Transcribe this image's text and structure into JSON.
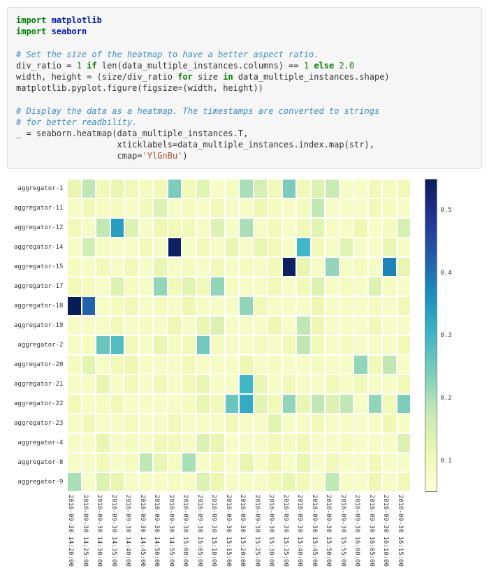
{
  "code": {
    "l1a": "import",
    "l1b": "matplotlib",
    "l2a": "import",
    "l2b": "seaborn",
    "c1": "# Set the size of the heatmap to have a better aspect ratio.",
    "l3": "div_ratio = 1 if len(data_multiple_instances.columns) == 1 else 2.0",
    "l4": "width, height = (size/div_ratio for size in data_multiple_instances.shape)",
    "l5": "matplotlib.pyplot.figure(figsize=(width, height))",
    "c2": "# Display the data as a heatmap. The timestamps are converted to strings",
    "c3": "# for better readbility.",
    "l6": "_ = seaborn.heatmap(data_multiple_instances.T,",
    "l7": "                    xticklabels=data_multiple_instances.index.map(str),",
    "l8": "                    cmap='YlGnBu')"
  },
  "chart_data": {
    "type": "heatmap",
    "cmap": "YlGnBu",
    "vmin": 0.05,
    "vmax": 0.55,
    "colorbar_ticks": [
      "0.1",
      "0.2",
      "0.3",
      "0.4",
      "0.5"
    ],
    "y_labels": [
      "aggregator-1",
      "aggregator-11",
      "aggregator-12",
      "aggregator-14",
      "aggregator-15",
      "aggregator-17",
      "aggregator-18",
      "aggregator-19",
      "aggregator-2",
      "aggregator-20",
      "aggregator-21",
      "aggregator-22",
      "aggregator-23",
      "aggregator-4",
      "aggregator-8",
      "aggregator-9"
    ],
    "x_labels": [
      "2016-09-30 14:20:00",
      "2016-09-30 14:25:00",
      "2016-09-30 14:30:00",
      "2016-09-30 14:35:00",
      "2016-09-30 14:40:00",
      "2016-09-30 14:45:00",
      "2016-09-30 14:50:00",
      "2016-09-30 14:55:00",
      "2016-09-30 15:00:00",
      "2016-09-30 15:05:00",
      "2016-09-30 15:10:00",
      "2016-09-30 15:15:00",
      "2016-09-30 15:20:00",
      "2016-09-30 15:25:00",
      "2016-09-30 15:30:00",
      "2016-09-30 15:35:00",
      "2016-09-30 15:40:00",
      "2016-09-30 15:45:00",
      "2016-09-30 15:50:00",
      "2016-09-30 15:55:00",
      "2016-09-30 16:00:00",
      "2016-09-30 16:05:00",
      "2016-09-30 16:10:00",
      "2016-09-30 16:15:00"
    ],
    "values": [
      [
        0.12,
        0.18,
        0.1,
        0.12,
        0.1,
        0.09,
        0.1,
        0.24,
        0.1,
        0.13,
        0.08,
        0.09,
        0.2,
        0.15,
        0.1,
        0.24,
        0.1,
        0.14,
        0.17,
        0.08,
        0.08,
        0.1,
        0.09,
        0.1
      ],
      [
        0.08,
        0.1,
        0.09,
        0.09,
        0.08,
        0.1,
        0.14,
        0.08,
        0.09,
        0.08,
        0.1,
        0.08,
        0.08,
        0.11,
        0.09,
        0.08,
        0.09,
        0.18,
        0.08,
        0.08,
        0.08,
        0.1,
        0.09,
        0.08
      ],
      [
        0.1,
        0.08,
        0.18,
        0.34,
        0.14,
        0.08,
        0.11,
        0.1,
        0.1,
        0.08,
        0.14,
        0.08,
        0.2,
        0.08,
        0.1,
        0.08,
        0.1,
        0.13,
        0.08,
        0.08,
        0.11,
        0.08,
        0.09,
        0.15
      ],
      [
        0.08,
        0.16,
        0.09,
        0.08,
        0.08,
        0.1,
        0.08,
        0.54,
        0.08,
        0.1,
        0.08,
        0.12,
        0.08,
        0.12,
        0.1,
        0.08,
        0.3,
        0.1,
        0.08,
        0.13,
        0.08,
        0.08,
        0.12,
        0.08
      ],
      [
        0.09,
        0.08,
        0.1,
        0.08,
        0.1,
        0.08,
        0.12,
        0.08,
        0.09,
        0.08,
        0.1,
        0.08,
        0.09,
        0.08,
        0.1,
        0.54,
        0.12,
        0.08,
        0.22,
        0.08,
        0.09,
        0.08,
        0.38,
        0.12
      ],
      [
        0.1,
        0.09,
        0.08,
        0.14,
        0.09,
        0.08,
        0.22,
        0.1,
        0.13,
        0.1,
        0.22,
        0.09,
        0.08,
        0.08,
        0.1,
        0.08,
        0.1,
        0.14,
        0.08,
        0.09,
        0.08,
        0.14,
        0.09,
        0.08
      ],
      [
        0.55,
        0.42,
        0.08,
        0.09,
        0.1,
        0.08,
        0.09,
        0.08,
        0.11,
        0.08,
        0.08,
        0.08,
        0.22,
        0.1,
        0.08,
        0.08,
        0.08,
        0.11,
        0.08,
        0.08,
        0.08,
        0.09,
        0.08,
        0.1
      ],
      [
        0.08,
        0.08,
        0.08,
        0.1,
        0.08,
        0.09,
        0.08,
        0.11,
        0.08,
        0.12,
        0.14,
        0.08,
        0.08,
        0.08,
        0.11,
        0.08,
        0.18,
        0.11,
        0.08,
        0.08,
        0.08,
        0.1,
        0.08,
        0.08
      ],
      [
        0.08,
        0.09,
        0.26,
        0.28,
        0.1,
        0.08,
        0.12,
        0.09,
        0.1,
        0.25,
        0.09,
        0.08,
        0.08,
        0.09,
        0.08,
        0.1,
        0.18,
        0.1,
        0.08,
        0.09,
        0.08,
        0.08,
        0.08,
        0.1
      ],
      [
        0.09,
        0.13,
        0.08,
        0.1,
        0.11,
        0.08,
        0.08,
        0.08,
        0.1,
        0.08,
        0.08,
        0.08,
        0.11,
        0.08,
        0.09,
        0.08,
        0.08,
        0.09,
        0.08,
        0.08,
        0.22,
        0.1,
        0.18,
        0.08
      ],
      [
        0.08,
        0.08,
        0.12,
        0.08,
        0.1,
        0.08,
        0.1,
        0.08,
        0.1,
        0.12,
        0.08,
        0.08,
        0.3,
        0.12,
        0.08,
        0.1,
        0.08,
        0.08,
        0.1,
        0.08,
        0.1,
        0.08,
        0.08,
        0.1
      ],
      [
        0.1,
        0.08,
        0.09,
        0.1,
        0.08,
        0.08,
        0.08,
        0.08,
        0.09,
        0.12,
        0.1,
        0.26,
        0.32,
        0.13,
        0.1,
        0.22,
        0.12,
        0.18,
        0.14,
        0.18,
        0.08,
        0.22,
        0.1,
        0.24
      ],
      [
        0.08,
        0.1,
        0.08,
        0.08,
        0.09,
        0.08,
        0.08,
        0.1,
        0.08,
        0.08,
        0.08,
        0.1,
        0.08,
        0.08,
        0.13,
        0.08,
        0.08,
        0.1,
        0.08,
        0.08,
        0.08,
        0.08,
        0.11,
        0.08
      ],
      [
        0.08,
        0.08,
        0.12,
        0.08,
        0.09,
        0.08,
        0.1,
        0.1,
        0.08,
        0.14,
        0.12,
        0.08,
        0.08,
        0.08,
        0.1,
        0.09,
        0.1,
        0.08,
        0.08,
        0.09,
        0.08,
        0.08,
        0.08,
        0.14
      ],
      [
        0.08,
        0.08,
        0.1,
        0.08,
        0.09,
        0.18,
        0.12,
        0.09,
        0.2,
        0.08,
        0.1,
        0.08,
        0.12,
        0.08,
        0.11,
        0.08,
        0.12,
        0.08,
        0.1,
        0.08,
        0.08,
        0.1,
        0.08,
        0.08
      ],
      [
        0.2,
        0.08,
        0.14,
        0.12,
        0.08,
        0.08,
        0.08,
        0.09,
        0.08,
        0.14,
        0.11,
        0.08,
        0.08,
        0.08,
        0.1,
        0.12,
        0.1,
        0.08,
        0.18,
        0.08,
        0.08,
        0.11,
        0.08,
        0.1
      ]
    ]
  }
}
